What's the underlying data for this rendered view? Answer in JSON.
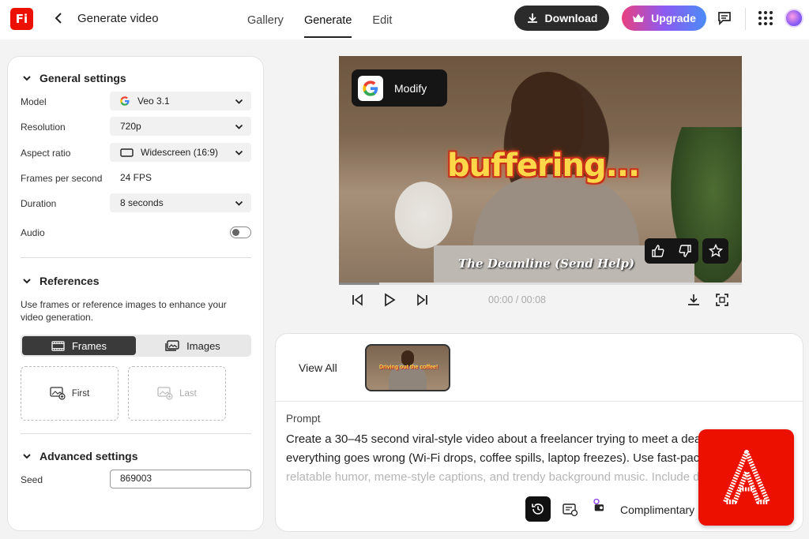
{
  "topbar": {
    "logo_text": "Fi",
    "title": "Generate video",
    "tabs": [
      {
        "label": "Gallery"
      },
      {
        "label": "Generate",
        "active": true
      },
      {
        "label": "Edit"
      }
    ],
    "download_label": "Download",
    "upgrade_label": "Upgrade"
  },
  "settings": {
    "general_title": "General settings",
    "model_label": "Model",
    "model_value": "Veo 3.1",
    "resolution_label": "Resolution",
    "resolution_value": "720p",
    "aspect_label": "Aspect ratio",
    "aspect_value": "Widescreen (16:9)",
    "fps_label": "Frames per second",
    "fps_value": "24 FPS",
    "duration_label": "Duration",
    "duration_value": "8 seconds",
    "audio_label": "Audio",
    "audio_on": false,
    "references_title": "References",
    "references_desc": "Use frames or reference images to enhance your video generation.",
    "frames_tab": "Frames",
    "images_tab": "Images",
    "first_label": "First",
    "last_label": "Last",
    "advanced_title": "Advanced settings",
    "seed_label": "Seed",
    "seed_value": "869003"
  },
  "video": {
    "modify_label": "Modify",
    "overlay_text": "buffering...",
    "subtitle_text": "The Deamline (Send Help)",
    "time": "00:00 / 00:08",
    "progress": 0.1
  },
  "history": {
    "view_all": "View All",
    "thumb_text": "Driving out the coffee!"
  },
  "prompt": {
    "label": "Prompt",
    "line1": "Create a 30–45 second viral-style video about a freelancer trying to meet a deadl",
    "line2": "everything goes wrong (Wi-Fi drops, coffee spills, laptop freezes). Use fast-paced",
    "line3": "relatable humor, meme-style captions, and trendy background music. Include dy",
    "credits_label": "Complimentary"
  },
  "colors": {
    "brand_red": "#eb1000",
    "dark_button": "#2b2b2b"
  }
}
